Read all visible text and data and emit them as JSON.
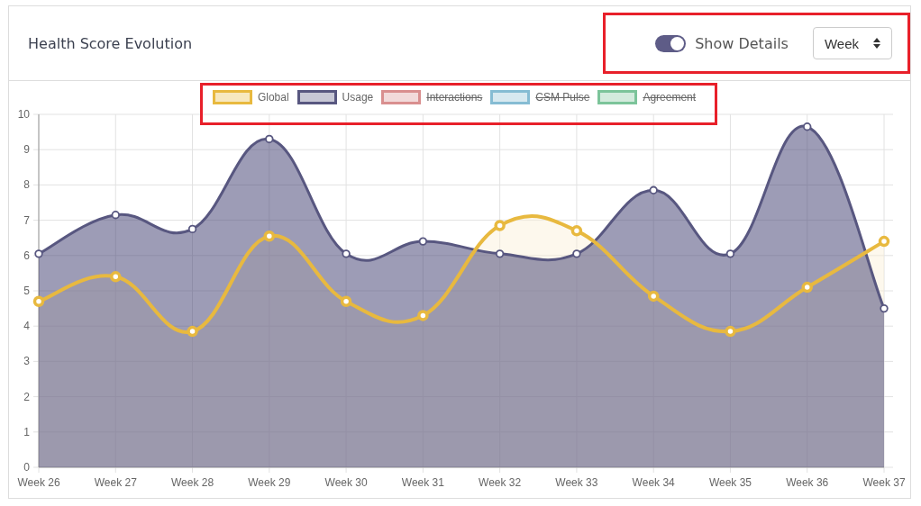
{
  "card": {
    "title": "Health Score Evolution"
  },
  "controls": {
    "highlighted": true,
    "toggle": {
      "label": "Show Details",
      "on": true
    },
    "period_select": {
      "value": "Week"
    }
  },
  "legend": {
    "highlighted": true,
    "items": [
      {
        "label": "Interactions",
        "color": "#d98f8f",
        "hidden": true
      },
      {
        "label": "CSM Pulse",
        "color": "#86bcd3",
        "hidden": true
      },
      {
        "label": "Agreement",
        "color": "#7cc49a",
        "hidden": true
      }
    ]
  },
  "chart_data": {
    "type": "area",
    "grid": true,
    "categories": [
      "Week 26",
      "Week 27",
      "Week 28",
      "Week 29",
      "Week 30",
      "Week 31",
      "Week 32",
      "Week 33",
      "Week 34",
      "Week 35",
      "Week 36",
      "Week 37"
    ],
    "ylim": [
      0,
      10
    ],
    "yticks": [
      0,
      1,
      2,
      3,
      4,
      5,
      6,
      7,
      8,
      9,
      10
    ],
    "series": [
      {
        "name": "Global",
        "color": "#e8b93f",
        "values": [
          4.7,
          5.4,
          3.85,
          6.55,
          4.7,
          4.3,
          6.85,
          6.7,
          4.85,
          3.85,
          5.1,
          6.4
        ]
      },
      {
        "name": "Usage",
        "color": "#585780",
        "values": [
          6.05,
          7.15,
          6.75,
          9.3,
          6.05,
          6.4,
          6.05,
          6.05,
          7.85,
          6.05,
          9.65,
          4.5
        ]
      }
    ]
  }
}
